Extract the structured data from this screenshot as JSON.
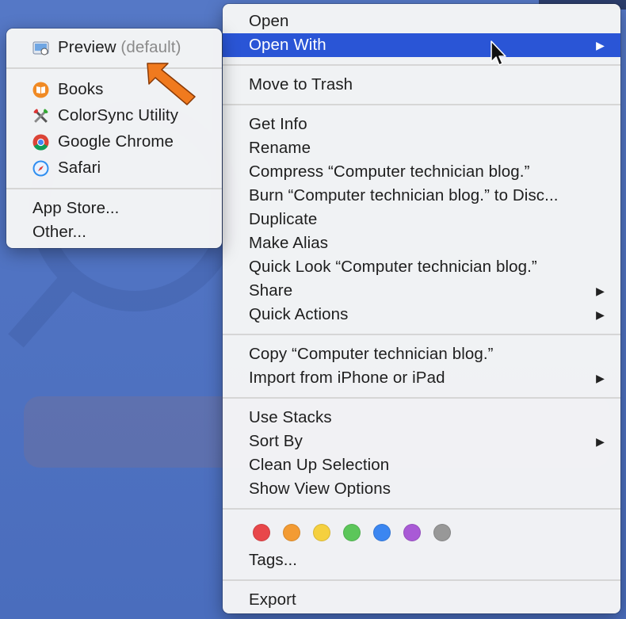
{
  "main_menu": {
    "items": [
      {
        "label": "Open"
      },
      {
        "label": "Open With",
        "submenu": true,
        "highlighted": true
      },
      {
        "label": "Move to Trash"
      },
      {
        "label": "Get Info"
      },
      {
        "label": "Rename"
      },
      {
        "label": "Compress “Computer technician blog.”"
      },
      {
        "label": "Burn “Computer technician blog.” to Disc..."
      },
      {
        "label": "Duplicate"
      },
      {
        "label": "Make Alias"
      },
      {
        "label": "Quick Look “Computer technician blog.”"
      },
      {
        "label": "Share",
        "submenu": true
      },
      {
        "label": "Quick Actions",
        "submenu": true
      },
      {
        "label": "Copy “Computer technician blog.”"
      },
      {
        "label": "Import from iPhone or iPad",
        "submenu": true
      },
      {
        "label": "Use Stacks"
      },
      {
        "label": "Sort By",
        "submenu": true
      },
      {
        "label": "Clean Up Selection"
      },
      {
        "label": "Show View Options"
      },
      {
        "label": "Tags..."
      },
      {
        "label": "Export"
      }
    ],
    "submenu_arrow": "▶",
    "tag_colors": [
      {
        "name": "red",
        "color": "#e8474a"
      },
      {
        "name": "orange",
        "color": "#f39b33"
      },
      {
        "name": "yellow",
        "color": "#f5d03f"
      },
      {
        "name": "green",
        "color": "#5cc65a"
      },
      {
        "name": "blue",
        "color": "#3b86f1"
      },
      {
        "name": "purple",
        "color": "#a95ad6"
      },
      {
        "name": "gray",
        "color": "#989898"
      }
    ]
  },
  "open_with_submenu": {
    "default_app": {
      "label": "Preview",
      "suffix": "(default)",
      "icon": "preview-icon"
    },
    "apps": [
      {
        "label": "Books",
        "icon": "books-icon",
        "color": "#f08a24"
      },
      {
        "label": "ColorSync Utility",
        "icon": "colorsync-utility-icon",
        "color": "#555555"
      },
      {
        "label": "Google Chrome",
        "icon": "chrome-icon",
        "color": "#db4437"
      },
      {
        "label": "Safari",
        "icon": "safari-icon",
        "color": "#2f8ef0"
      }
    ],
    "extra": [
      {
        "label": "App Store..."
      },
      {
        "label": "Other..."
      }
    ]
  },
  "colors": {
    "highlight": "#2a55d6",
    "callout_arrow": "#f07a1e",
    "desktop": "#4a6fbf"
  }
}
